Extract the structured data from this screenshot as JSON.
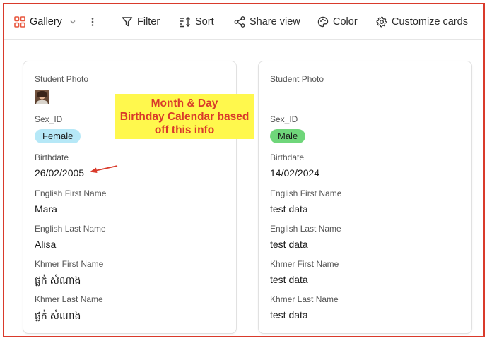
{
  "toolbar": {
    "gallery_label": "Gallery",
    "filter_label": "Filter",
    "sort_label": "Sort",
    "share_label": "Share view",
    "color_label": "Color",
    "customize_label": "Customize cards"
  },
  "cards": [
    {
      "photo_label": "Student Photo",
      "sex_label": "Sex_ID",
      "sex_value": "Female",
      "sex_color": "#b6e8f7",
      "birth_label": "Birthdate",
      "birth_value": "26/02/2005",
      "en_first_label": "English First Name",
      "en_first_value": "Mara",
      "en_last_label": "English Last Name",
      "en_last_value": "Alisa",
      "kh_first_label": "Khmer First Name",
      "kh_first_value": "ផ្លក់ សំណាង",
      "kh_last_label": "Khmer Last Name",
      "kh_last_value": "ផ្លក់ សំណាង"
    },
    {
      "photo_label": "Student Photo",
      "sex_label": "Sex_ID",
      "sex_value": "Male",
      "sex_color": "#6fd67a",
      "birth_label": "Birthdate",
      "birth_value": "14/02/2024",
      "en_first_label": "English First Name",
      "en_first_value": "test data",
      "en_last_label": "English Last Name",
      "en_last_value": "test data",
      "kh_first_label": "Khmer First Name",
      "kh_first_value": "test data",
      "kh_last_label": "Khmer Last Name",
      "kh_last_value": "test data"
    }
  ],
  "annotation": {
    "line1": "Month & Day",
    "line2": "Birthday Calendar based",
    "line3": "off this info",
    "color": "#d93a2b",
    "background": "#fff84d"
  }
}
